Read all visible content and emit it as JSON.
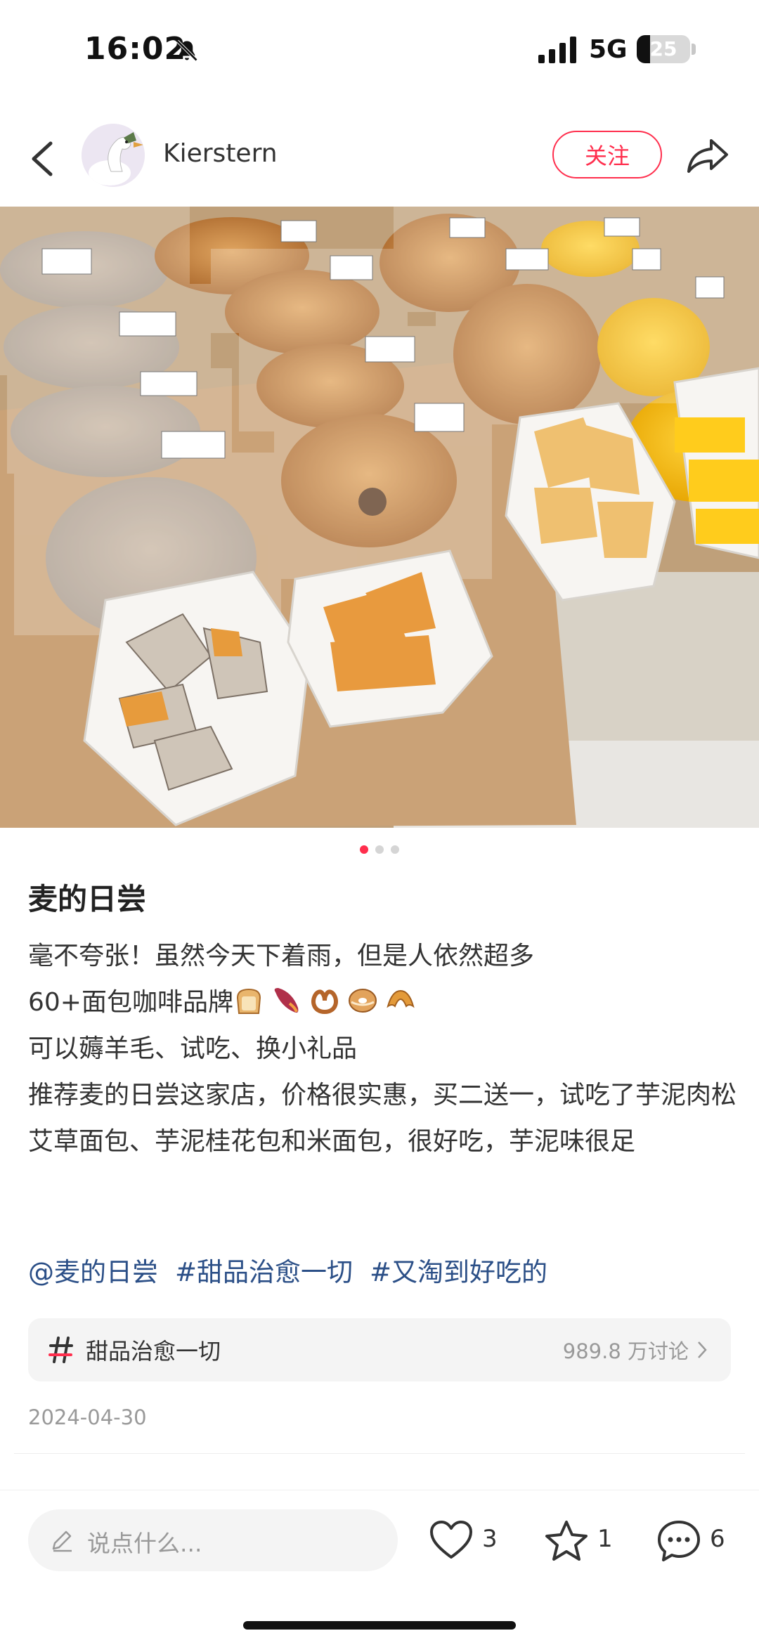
{
  "status_bar": {
    "time": "16:02",
    "network": "5G",
    "battery_level": "25"
  },
  "header": {
    "username": "Kierstern",
    "follow_label": "关注"
  },
  "photo": {
    "page_count": 3,
    "active_page": 1
  },
  "post": {
    "title": "麦的日尝",
    "lines": [
      "毫不夸张！虽然今天下着雨，但是人依然超多",
      "60+面包咖啡品牌",
      "可以薅羊毛、试吃、换小礼品",
      "推荐麦的日尝这家店，价格很实惠，买二送一，试吃了芋泥肉松艾草面包、芋泥桂花包和米面包，很好吃，芋泥味很足"
    ],
    "emojis": [
      "bread-emoji",
      "sweet-potato-emoji",
      "pretzel-emoji",
      "bagel-emoji",
      "croissant-emoji"
    ],
    "tags": [
      "@麦的日尝",
      "#甜品治愈一切",
      "#又淘到好吃的"
    ],
    "topic": {
      "name": "甜品治愈一切",
      "count": "989.8 万讨论"
    },
    "date": "2024-04-30"
  },
  "bottom_bar": {
    "comment_placeholder": "说点什么...",
    "likes": "3",
    "stars": "1",
    "comments": "6"
  },
  "colors": {
    "accent": "#ff2e4d",
    "tag": "#2b4f87",
    "muted": "#999999"
  }
}
